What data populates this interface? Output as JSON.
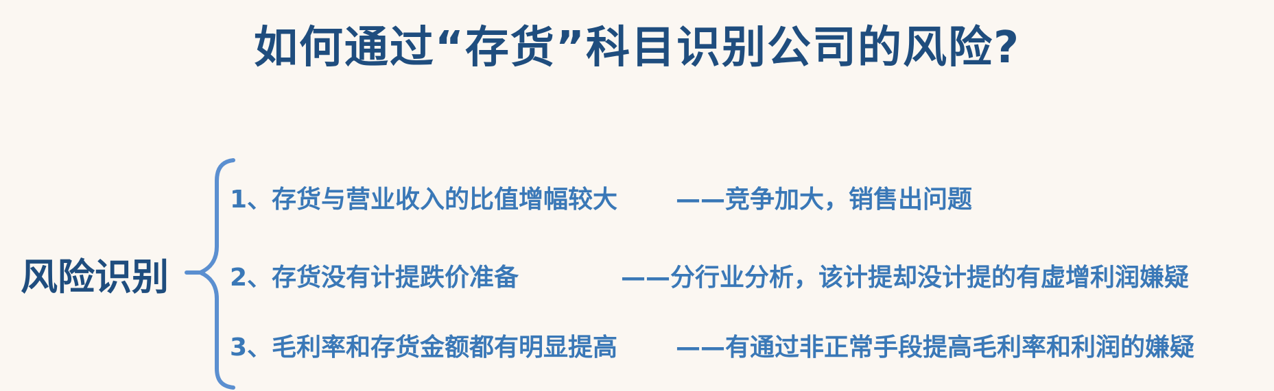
{
  "title": "如何通过“存货”科目识别公司的风险?",
  "root_label": "风险识别",
  "items": [
    {
      "left": "1、存货与营业收入的比值增幅较大",
      "right": "——竞争加大，销售出问题"
    },
    {
      "left": "2、存货没有计提跌价准备",
      "right": "——分行业分析，该计提却没计提的有虚增利润嫌疑"
    },
    {
      "left": "3、毛利率和存货金额都有明显提高",
      "right": "——有通过非正常手段提高毛利率和利润的嫌疑"
    }
  ],
  "colors": {
    "background": "#fbf7f2",
    "title": "#1f4d7e",
    "item_text": "#3a78b7",
    "bracket": "#5b8fd0"
  }
}
